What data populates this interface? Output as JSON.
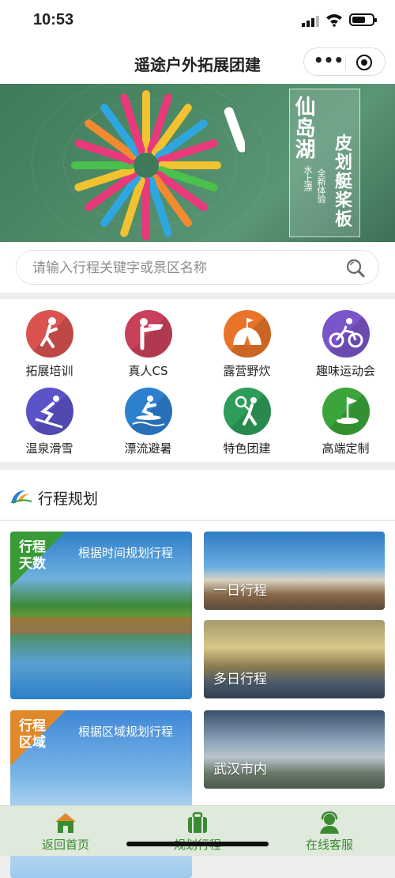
{
  "status_bar": {
    "time": "10:53"
  },
  "navbar": {
    "title": "遥途户外拓展团建",
    "more_label": "•••"
  },
  "banner": {
    "title_main": "仙岛湖",
    "title_sub": "皮划艇桨板",
    "small_1": "水上漂",
    "small_2": "全新体验",
    "colors": {
      "water": "#4d8a66"
    }
  },
  "search": {
    "placeholder": "请输入行程关键字或景区名称"
  },
  "categories": [
    {
      "label": "拓展培训",
      "icon": "climber-icon",
      "color": "#d9534f"
    },
    {
      "label": "真人CS",
      "icon": "shooter-icon",
      "color": "#c9405b"
    },
    {
      "label": "露营野炊",
      "icon": "tent-icon",
      "color": "#e8742a"
    },
    {
      "label": "趣味运动会",
      "icon": "cyclist-icon",
      "color": "#7a55c9"
    },
    {
      "label": "温泉滑雪",
      "icon": "skier-icon",
      "color": "#5b54c9"
    },
    {
      "label": "漂流避暑",
      "icon": "surfer-icon",
      "color": "#2d7fd0"
    },
    {
      "label": "特色团建",
      "icon": "tennis-icon",
      "color": "#2e9c5a"
    },
    {
      "label": "高端定制",
      "icon": "golf-icon",
      "color": "#3ba43a"
    }
  ],
  "plan": {
    "title": "行程规划",
    "big_cards": [
      {
        "ribbon_line1": "行程",
        "ribbon_line2": "天数",
        "caption": "根据时间规划行程",
        "ribbon_color": "#3a9a38"
      },
      {
        "ribbon_line1": "行程",
        "ribbon_line2": "区域",
        "caption": "根据区域规划行程",
        "ribbon_color": "#e0892a"
      }
    ],
    "small_cards": [
      {
        "label": "一日行程"
      },
      {
        "label": "多日行程"
      },
      {
        "label": "武汉市内"
      }
    ]
  },
  "tabbar": [
    {
      "label": "返回首页",
      "icon": "home-icon"
    },
    {
      "label": "规划行程",
      "icon": "suitcase-icon"
    },
    {
      "label": "在线客服",
      "icon": "customer-service-icon"
    }
  ],
  "accent": "#3b8b32"
}
